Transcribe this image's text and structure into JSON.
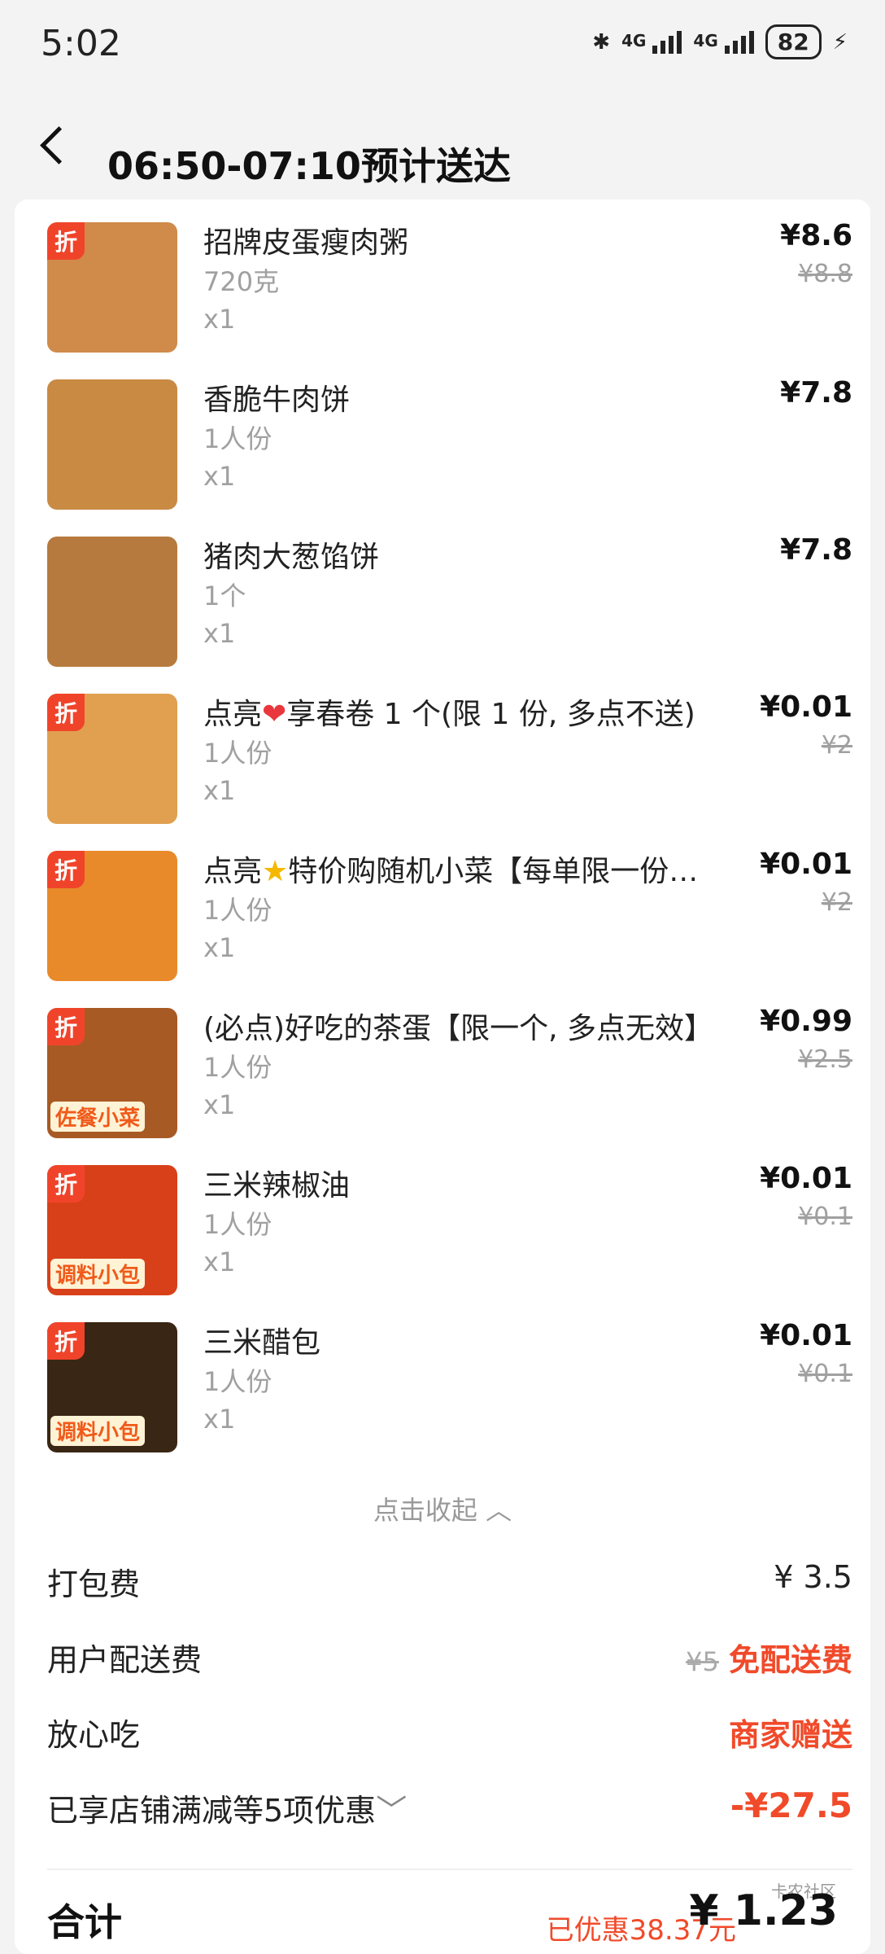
{
  "status": {
    "time": "5:02",
    "battery": "82"
  },
  "header": {
    "title": "06:50-07:10预计送达"
  },
  "items": [
    {
      "name": "招牌皮蛋瘦肉粥",
      "spec": "720克",
      "qty": "x1",
      "price": "¥8.6",
      "orig": "¥8.8",
      "discount_tag": "折",
      "thumb_color": "#d08a4a"
    },
    {
      "name": "香脆牛肉饼",
      "spec": "1人份",
      "qty": "x1",
      "price": "¥7.8",
      "orig": "",
      "discount_tag": "",
      "thumb_color": "#c98a44"
    },
    {
      "name": "猪肉大葱馅饼",
      "spec": "1个",
      "qty": "x1",
      "price": "¥7.8",
      "orig": "",
      "discount_tag": "",
      "thumb_color": "#b67a3e"
    },
    {
      "name_prefix": "点亮",
      "icon": "heart-icon",
      "name_suffix": "享春卷 1 个(限 1 份, 多点不送)",
      "spec": "1人份",
      "qty": "x1",
      "price": "¥0.01",
      "orig": "¥2",
      "discount_tag": "折",
      "thumb_color": "#e0a050"
    },
    {
      "name_prefix": "点亮",
      "icon": "star-icon",
      "name_suffix": "特价购随机小菜【每单限一份…",
      "spec": "1人份",
      "qty": "x1",
      "price": "¥0.01",
      "orig": "¥2",
      "discount_tag": "折",
      "thumb_color": "#e88a2a"
    },
    {
      "name": "(必点)好吃的茶蛋【限一个, 多点无效】",
      "spec": "1人份",
      "qty": "x1",
      "price": "¥0.99",
      "orig": "¥2.5",
      "discount_tag": "折",
      "tag": "佐餐小菜",
      "thumb_color": "#a85a24"
    },
    {
      "name": "三米辣椒油",
      "spec": "1人份",
      "qty": "x1",
      "price": "¥0.01",
      "orig": "¥0.1",
      "discount_tag": "折",
      "tag": "调料小包",
      "thumb_color": "#d8401a"
    },
    {
      "name": "三米醋包",
      "spec": "1人份",
      "qty": "x1",
      "price": "¥0.01",
      "orig": "¥0.1",
      "discount_tag": "折",
      "tag": "调料小包",
      "thumb_color": "#3a2614"
    }
  ],
  "collapse_label": "点击收起",
  "fees": {
    "packing_label": "打包费",
    "packing_value": "¥ 3.5",
    "delivery_label": "用户配送费",
    "delivery_orig": "¥5",
    "delivery_value": "免配送费",
    "safe_label": "放心吃",
    "safe_value": "商家赠送",
    "discount_label": "已享店铺满减等5项优惠",
    "discount_value": "-¥27.5"
  },
  "total": {
    "label": "合计",
    "saved": "已优惠38.37元",
    "amount": "¥ 1.23"
  },
  "watermark": "卡农社区"
}
